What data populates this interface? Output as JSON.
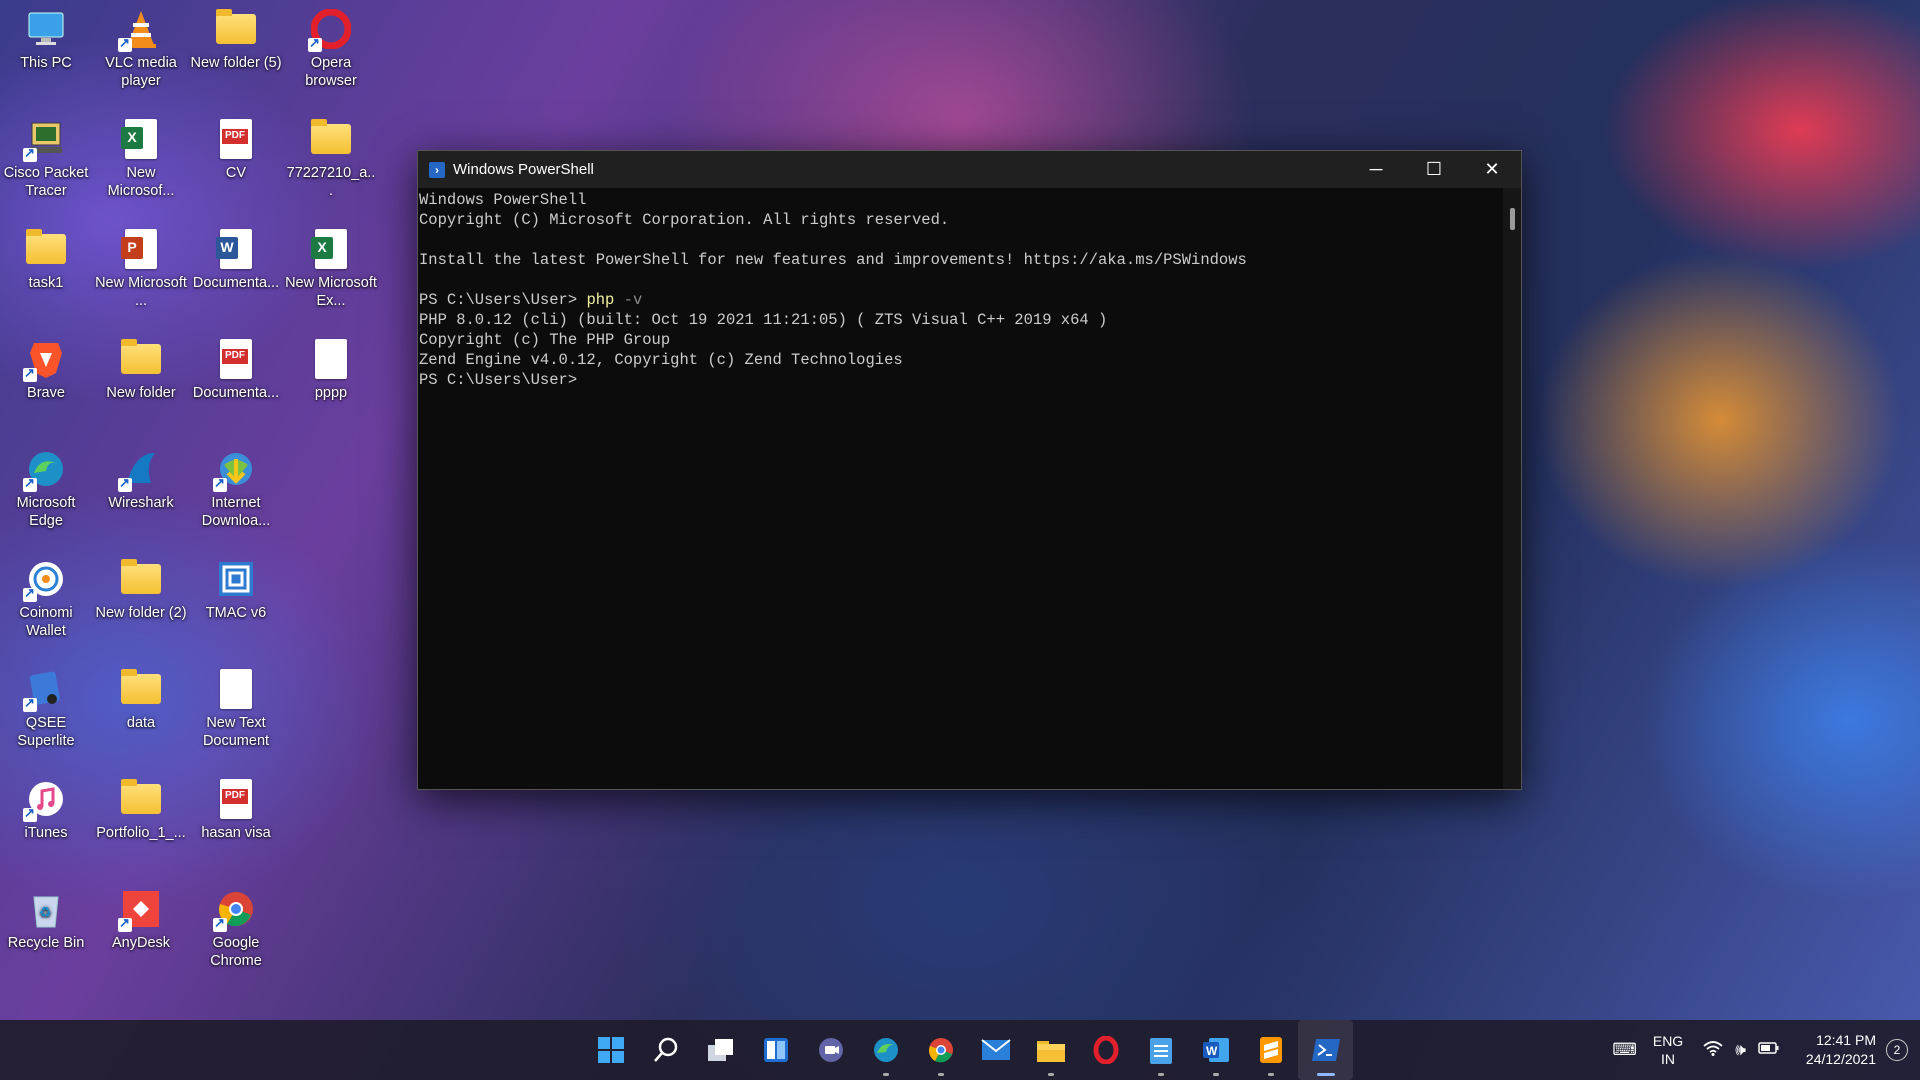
{
  "desktop": {
    "icons": [
      {
        "label": "This PC"
      },
      {
        "label": "VLC media player"
      },
      {
        "label": "New folder (5)"
      },
      {
        "label": "Opera browser"
      },
      {
        "label": "Cisco Packet Tracer"
      },
      {
        "label": "New Microsof..."
      },
      {
        "label": "CV"
      },
      {
        "label": "77227210_a..."
      },
      {
        "label": "task1"
      },
      {
        "label": "New Microsoft ..."
      },
      {
        "label": "Documenta..."
      },
      {
        "label": "New Microsoft Ex..."
      },
      {
        "label": "Brave"
      },
      {
        "label": "New folder"
      },
      {
        "label": "Documenta..."
      },
      {
        "label": "pppp"
      },
      {
        "label": "Microsoft Edge"
      },
      {
        "label": "Wireshark"
      },
      {
        "label": "Internet Downloa..."
      },
      {
        "label": "Coinomi Wallet"
      },
      {
        "label": "New folder (2)"
      },
      {
        "label": "TMAC v6"
      },
      {
        "label": "QSEE Superlite"
      },
      {
        "label": "data"
      },
      {
        "label": "New Text Document"
      },
      {
        "label": "iTunes"
      },
      {
        "label": "Portfolio_1_..."
      },
      {
        "label": "hasan visa"
      },
      {
        "label": "Recycle Bin"
      },
      {
        "label": "AnyDesk"
      },
      {
        "label": "Google Chrome"
      }
    ]
  },
  "window": {
    "title": "Windows PowerShell",
    "minimize": "─",
    "maximize": "☐",
    "close": "✕",
    "lines": [
      "Windows PowerShell",
      "Copyright (C) Microsoft Corporation. All rights reserved.",
      "",
      "Install the latest PowerShell for new features and improvements! https://aka.ms/PSWindows",
      "",
      "PS C:\\Users\\User> ",
      "PHP 8.0.12 (cli) (built: Oct 19 2021 11:21:05) ( ZTS Visual C++ 2019 x64 )",
      "Copyright (c) The PHP Group",
      "Zend Engine v4.0.12, Copyright (c) Zend Technologies",
      "PS C:\\Users\\User>"
    ],
    "command": "php",
    "command_arg": " -v"
  },
  "taskbar": {
    "apps": [
      {
        "name": "start"
      },
      {
        "name": "search"
      },
      {
        "name": "task-view"
      },
      {
        "name": "widgets"
      },
      {
        "name": "teams-chat"
      },
      {
        "name": "edge"
      },
      {
        "name": "chrome"
      },
      {
        "name": "mail"
      },
      {
        "name": "file-explorer"
      },
      {
        "name": "opera"
      },
      {
        "name": "notepad"
      },
      {
        "name": "word"
      },
      {
        "name": "sublime-text"
      },
      {
        "name": "powershell"
      }
    ],
    "lang_top": "ENG",
    "lang_bottom": "IN",
    "time": "12:41 PM",
    "date": "24/12/2021",
    "notifications": "2"
  }
}
